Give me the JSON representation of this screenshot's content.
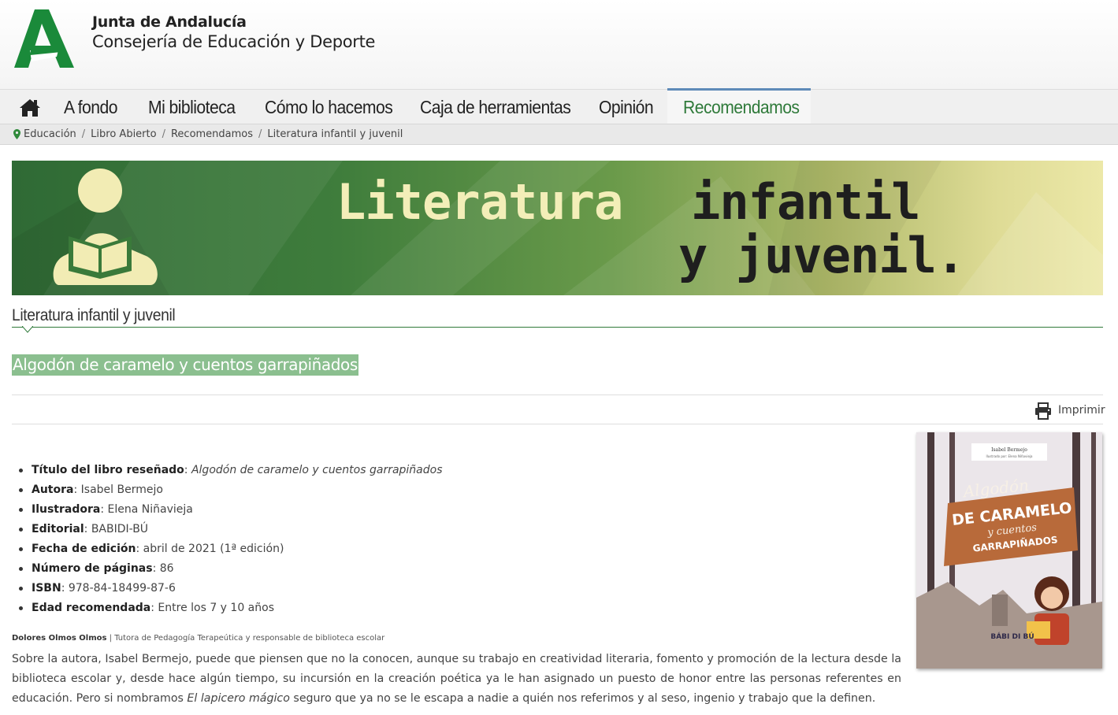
{
  "header": {
    "org_line1": "Junta de Andalucía",
    "org_line2": "Consejería de Educación y Deporte",
    "logo_color": "#1a8a3a"
  },
  "nav": {
    "items": [
      "A fondo",
      "Mi biblioteca",
      "Cómo lo hacemos",
      "Caja de herramientas",
      "Opinión",
      "Recomendamos"
    ],
    "active": "Recomendamos",
    "active_color": "#2f7a3a"
  },
  "breadcrumb": [
    "Educación",
    "Libro Abierto",
    "Recomendamos",
    "Literatura infantil y juvenil"
  ],
  "banner": {
    "line1_a": "Literatura",
    "line1_b": "infantil",
    "line2": "y juvenil."
  },
  "section_title": "Literatura infantil y juvenil",
  "article_title": "Algodón de caramelo y cuentos garrapiñados",
  "print_label": "Imprimir",
  "cover": {
    "author": "Isabel Bermejo",
    "illustrator_credit": "Ilustrado por: Elena Niñavieja",
    "title_line1": "Algodón",
    "title_line2": "DE CARAMELO",
    "title_line3": "y cuentos",
    "title_line4": "GARRAPIÑADOS",
    "publisher_mark": "BÁBI DI BÚ"
  },
  "details": [
    {
      "label": "Título del libro reseñado",
      "value": "Algodón de caramelo y cuentos garrapiñados"
    },
    {
      "label": "Autora",
      "value": "Isabel Bermejo"
    },
    {
      "label": "Ilustradora",
      "value": "Elena Niñavieja"
    },
    {
      "label": "Editorial",
      "value": "BABIDI-BÚ"
    },
    {
      "label": "Fecha de edición",
      "value": "abril de 2021 (1ª edición)"
    },
    {
      "label": "Número de páginas",
      "value": "86"
    },
    {
      "label": "ISBN",
      "value": "978-84-18499-87-6"
    },
    {
      "label": "Edad recomendada",
      "value": "Entre los 7 y 10 años"
    }
  ],
  "reviewer": {
    "name": "Dolores Olmos Olmos",
    "role": "Tutora de Pedagogía Terapeútica y responsable de biblioteca escolar"
  },
  "body": {
    "part1": "Sobre la autora, Isabel Bermejo, puede que piensen que no la conocen, aunque su trabajo en creatividad literaria, fomento y promoción de la lectura desde la biblioteca escolar y, desde hace algún tiempo, su incursión en la creación poética ya le han asignado un puesto de honor entre las personas referentes en educación. Pero si nombramos ",
    "italic": "El lapicero mágico",
    "part2": " seguro que ya no se le escapa a nadie a quién nos referimos y al seso, ingenio y trabajo que la definen."
  }
}
